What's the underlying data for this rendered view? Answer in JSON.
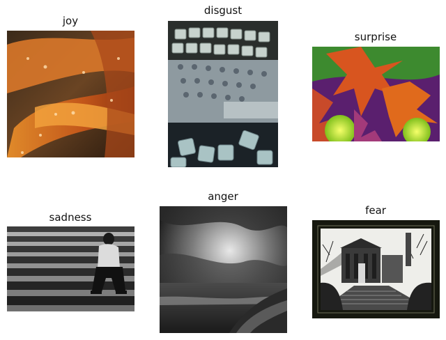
{
  "panels": [
    {
      "title": "joy",
      "image": "orange-lily-petals-with-water-drops"
    },
    {
      "title": "disgust",
      "image": "dirty-broken-keyboard-keys"
    },
    {
      "title": "surprise",
      "image": "oversaturated-red-autumn-leaves"
    },
    {
      "title": "sadness",
      "image": "man-sitting-on-stone-steps-head-in-hands"
    },
    {
      "title": "anger",
      "image": "stormy-clouds-over-beach"
    },
    {
      "title": "fear",
      "image": "dark-mausoleum-with-steps"
    }
  ]
}
